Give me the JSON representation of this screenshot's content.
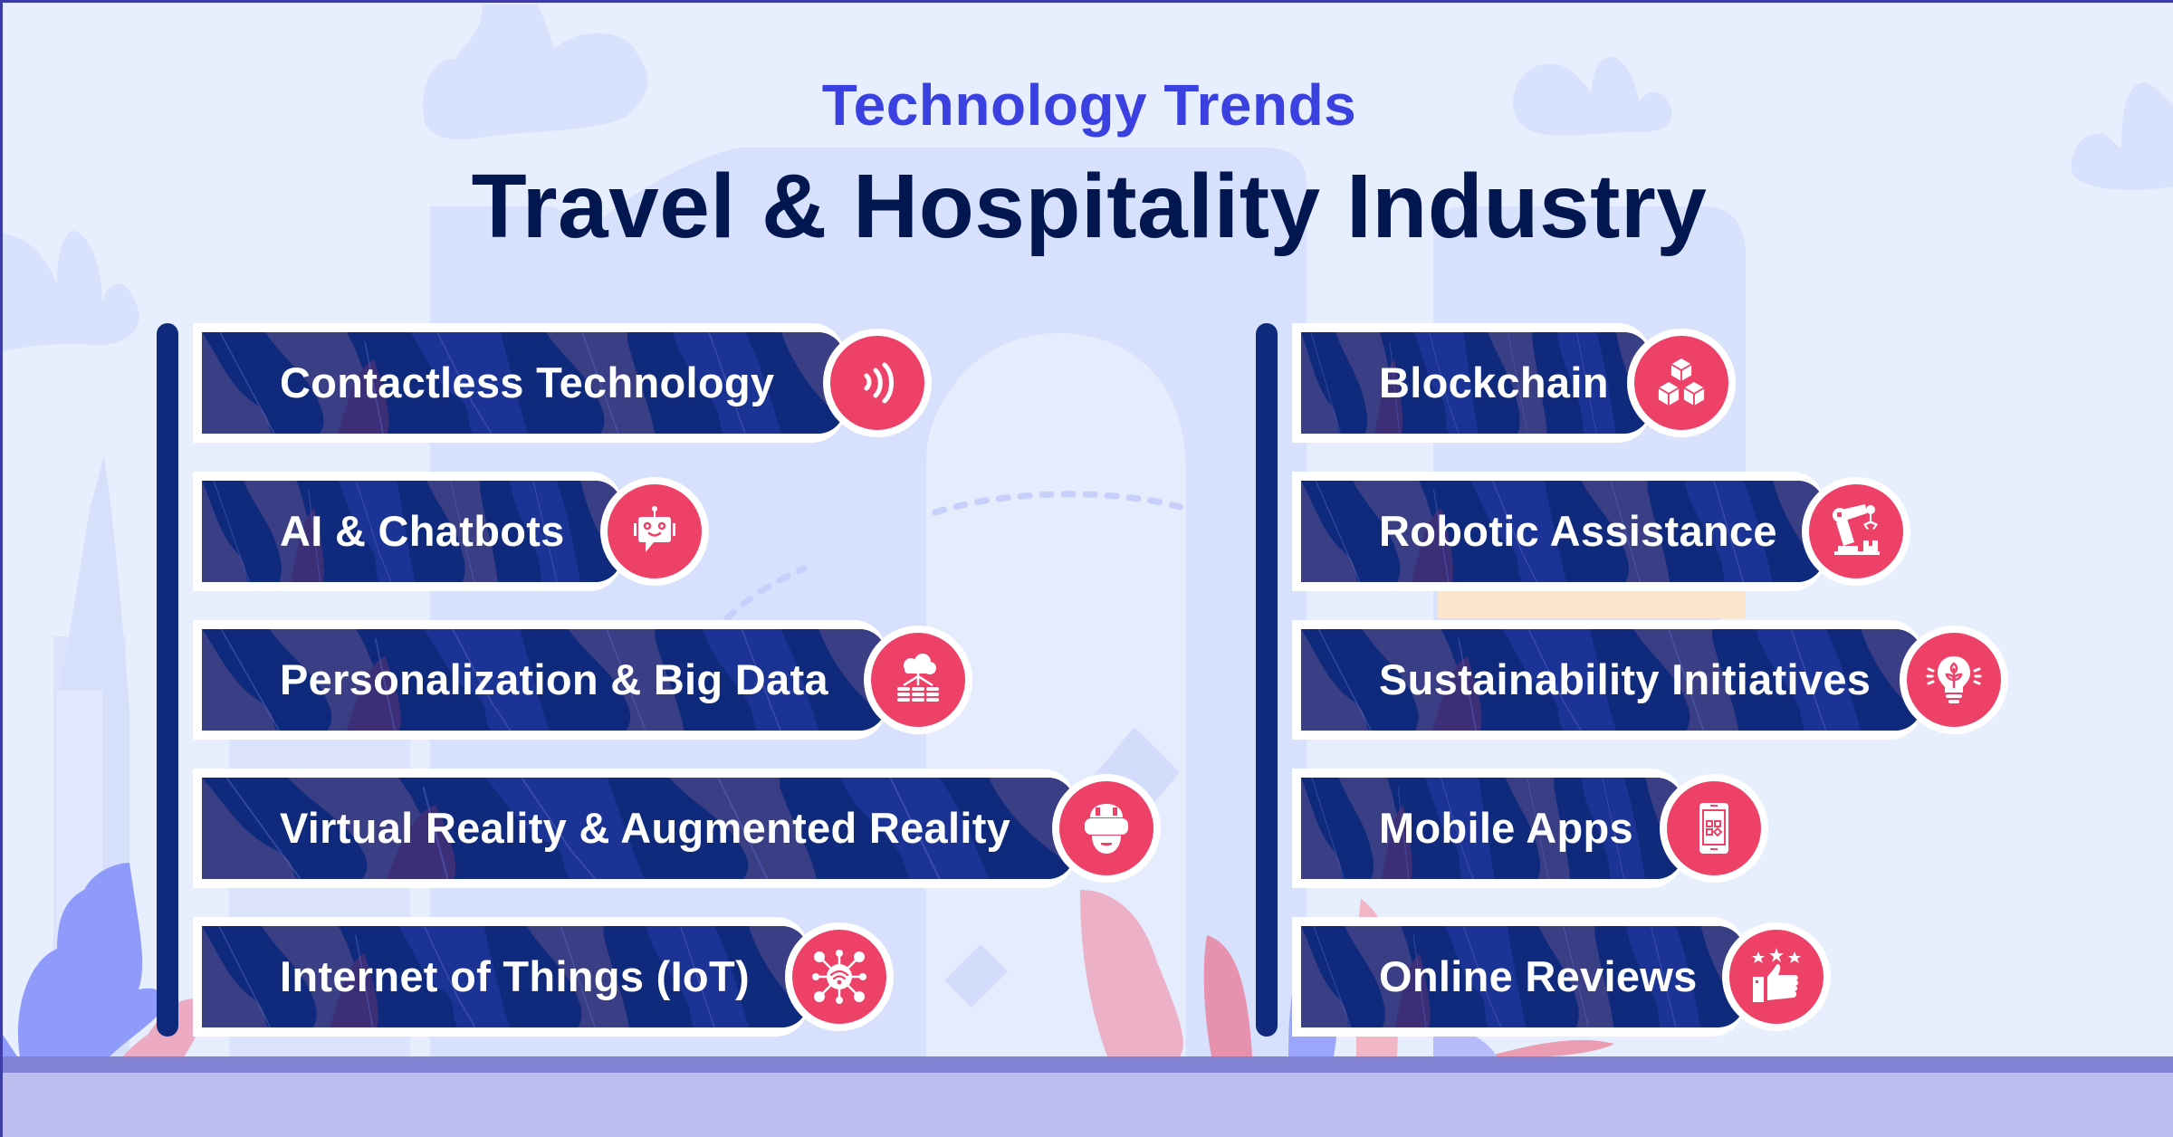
{
  "header": {
    "subtitle": "Technology Trends",
    "title": "Travel & Hospitality Industry"
  },
  "colors": {
    "background": "#e7eefe",
    "subtitle": "#3a41e0",
    "title": "#02174f",
    "banner": "#0f2a7c",
    "icon_circle": "#ee4168",
    "ground": "#bdbdef"
  },
  "left_column": {
    "items": [
      {
        "label": "Contactless Technology",
        "icon": "contactless-icon"
      },
      {
        "label": "AI & Chatbots",
        "icon": "chatbot-icon"
      },
      {
        "label": "Personalization & Big Data",
        "icon": "cloud-database-icon"
      },
      {
        "label": "Virtual Reality & Augmented Reality",
        "icon": "vr-headset-icon"
      },
      {
        "label": "Internet of Things (IoT)",
        "icon": "iot-network-icon"
      }
    ]
  },
  "right_column": {
    "items": [
      {
        "label": "Blockchain",
        "icon": "blocks-icon"
      },
      {
        "label": "Robotic Assistance",
        "icon": "robot-arm-icon"
      },
      {
        "label": "Sustainability Initiatives",
        "icon": "eco-bulb-icon"
      },
      {
        "label": "Mobile Apps",
        "icon": "mobile-app-icon"
      },
      {
        "label": "Online Reviews",
        "icon": "thumbs-up-stars-icon"
      }
    ]
  }
}
